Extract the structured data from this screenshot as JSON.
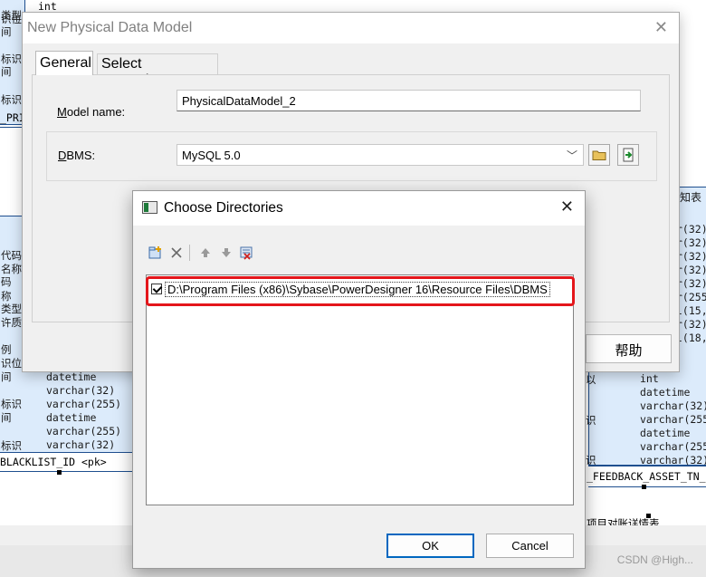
{
  "background": {
    "left_table": {
      "top_rows": [
        "类型",
        "识位",
        "间",
        "标识",
        "间",
        "标识"
      ],
      "top_types": [
        "int"
      ],
      "pri_label": "_PRI",
      "mid_rows": [
        "代码",
        "名称",
        "码",
        "称",
        "类型",
        "许质",
        "例",
        "识位",
        "间",
        "标识",
        "间",
        "标识"
      ],
      "types": [
        "datetime",
        "varchar(32)",
        "varchar(255)",
        "datetime",
        "varchar(255)",
        "varchar(32)"
      ],
      "pk_line": "BLACKLIST_ID  <pk>"
    },
    "right_table": {
      "header": "知表",
      "cols": [
        "r(32)",
        "r(32)",
        "r(32)",
        "r(32)",
        "r(32)",
        "r(255",
        "l(15,",
        "r(32)",
        "l(18,"
      ],
      "side_marks": [
        "以",
        "识",
        "识"
      ],
      "types": [
        "int",
        "datetime",
        "varchar(32)",
        "varchar(255",
        "datetime",
        "varchar(255",
        "varchar(32)"
      ],
      "fk_line": "_FEEDBACK_ASSET_TN_",
      "bottom_text": "项目对账详情表"
    },
    "watermark": "CSDN @High..."
  },
  "new_model_dialog": {
    "title": "New Physical Data Model",
    "tabs": [
      "General",
      "Select Extensions"
    ],
    "model_name_label": "Model name:",
    "model_name_mnemonic": "M",
    "model_name_rest": "odel name:",
    "model_name_value": "PhysicalDataModel_2",
    "dbms_label_mnemonic": "D",
    "dbms_label_rest": "BMS:",
    "dbms_value": "MySQL 5.0",
    "help_button": "帮助"
  },
  "choose_dirs_dialog": {
    "title": "Choose Directories",
    "toolbar": [
      "add-folder-icon",
      "delete-icon",
      "move-up-icon",
      "move-down-icon",
      "clear-icon"
    ],
    "directories": [
      {
        "path": "D:\\Program Files (x86)\\Sybase\\PowerDesigner 16\\Resource Files\\DBMS",
        "checked": true
      }
    ],
    "ok_label": "OK",
    "cancel_label": "Cancel"
  },
  "colors": {
    "highlight": "#e4161b",
    "table_fill": "#dcebfb",
    "ok_border": "#0067c0"
  }
}
